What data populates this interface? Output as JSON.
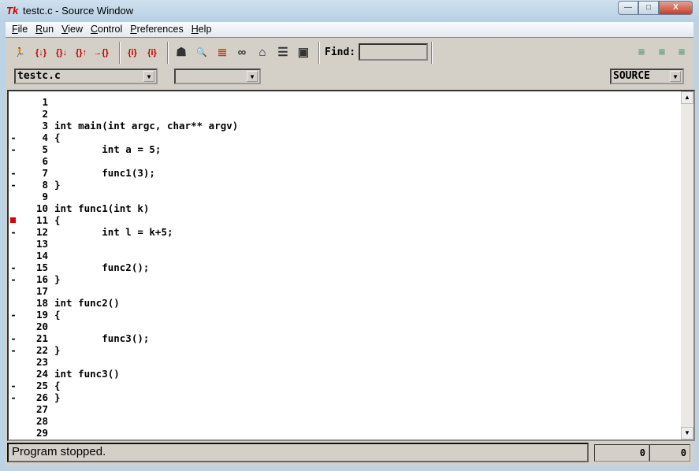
{
  "window": {
    "title": "testc.c - Source Window",
    "logo": "Tk",
    "min": "—",
    "max": "□",
    "close": "X"
  },
  "menu": [
    {
      "first": "F",
      "rest": "ile"
    },
    {
      "first": "R",
      "rest": "un"
    },
    {
      "first": "V",
      "rest": "iew"
    },
    {
      "first": "C",
      "rest": "ontrol"
    },
    {
      "first": "P",
      "rest": "references"
    },
    {
      "first": "H",
      "rest": "elp"
    }
  ],
  "toolbar": {
    "find_label": "Find:",
    "find_value": "",
    "icons": [
      "run-icon",
      "step-icon",
      "next-icon",
      "finish-icon",
      "continue-icon",
      "stepi-icon",
      "nexti-icon",
      "registers-icon",
      "memory-icon",
      "stack-icon",
      "watch-icon",
      "locals-icon",
      "breakpoints-icon",
      "console-icon",
      "frame-down-icon",
      "frame-up-icon",
      "frame-bottom-icon"
    ]
  },
  "file_combo": "testc.c",
  "func_combo": "",
  "mode_combo": "SOURCE",
  "source": [
    {
      "n": "1",
      "m": "",
      "c": ""
    },
    {
      "n": "2",
      "m": "",
      "c": ""
    },
    {
      "n": "3",
      "m": "",
      "c": "int main(int argc, char** argv)"
    },
    {
      "n": "4",
      "m": "-",
      "c": "{"
    },
    {
      "n": "5",
      "m": "-",
      "c": "        int a = 5;"
    },
    {
      "n": "6",
      "m": "",
      "c": ""
    },
    {
      "n": "7",
      "m": "-",
      "c": "        func1(3);"
    },
    {
      "n": "8",
      "m": "-",
      "c": "}"
    },
    {
      "n": "9",
      "m": "",
      "c": ""
    },
    {
      "n": "10",
      "m": "",
      "c": "int func1(int k)"
    },
    {
      "n": "11",
      "m": "bp",
      "c": "{"
    },
    {
      "n": "12",
      "m": "-",
      "c": "        int l = k+5;"
    },
    {
      "n": "13",
      "m": "",
      "c": ""
    },
    {
      "n": "14",
      "m": "",
      "c": ""
    },
    {
      "n": "15",
      "m": "-",
      "c": "        func2();"
    },
    {
      "n": "16",
      "m": "-",
      "c": "}"
    },
    {
      "n": "17",
      "m": "",
      "c": ""
    },
    {
      "n": "18",
      "m": "",
      "c": "int func2()"
    },
    {
      "n": "19",
      "m": "-",
      "c": "{"
    },
    {
      "n": "20",
      "m": "",
      "c": ""
    },
    {
      "n": "21",
      "m": "-",
      "c": "        func3();"
    },
    {
      "n": "22",
      "m": "-",
      "c": "}"
    },
    {
      "n": "23",
      "m": "",
      "c": ""
    },
    {
      "n": "24",
      "m": "",
      "c": "int func3()"
    },
    {
      "n": "25",
      "m": "-",
      "c": "{"
    },
    {
      "n": "26",
      "m": "-",
      "c": "}"
    },
    {
      "n": "27",
      "m": "",
      "c": ""
    },
    {
      "n": "28",
      "m": "",
      "c": ""
    },
    {
      "n": "29",
      "m": "",
      "c": ""
    }
  ],
  "status": {
    "message": "Program stopped.",
    "count1": "0",
    "count2": "0"
  },
  "colors": {
    "breakpoint": "#e00000"
  }
}
